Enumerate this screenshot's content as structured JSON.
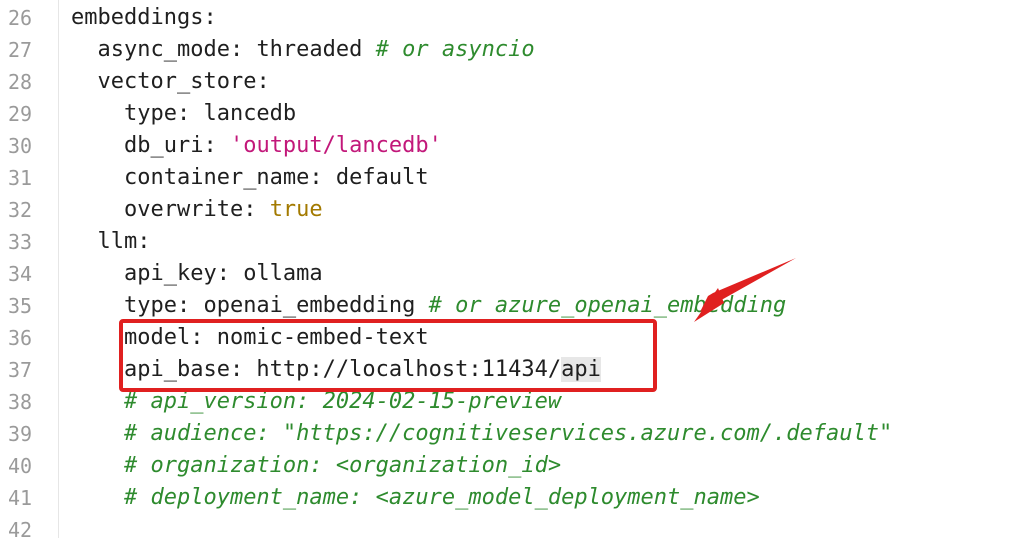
{
  "editor": {
    "lines": [
      {
        "num": "26",
        "indent": "",
        "parts": [
          {
            "t": "embeddings:",
            "c": "key"
          }
        ]
      },
      {
        "num": "27",
        "indent": "  ",
        "parts": [
          {
            "t": "async_mode: threaded ",
            "c": "key"
          },
          {
            "t": "# or asyncio",
            "c": "cmt"
          }
        ]
      },
      {
        "num": "28",
        "indent": "  ",
        "parts": [
          {
            "t": "vector_store:",
            "c": "key"
          }
        ]
      },
      {
        "num": "29",
        "indent": "    ",
        "parts": [
          {
            "t": "type: lancedb",
            "c": "key"
          }
        ]
      },
      {
        "num": "30",
        "indent": "    ",
        "parts": [
          {
            "t": "db_uri: ",
            "c": "key"
          },
          {
            "t": "'output/lancedb'",
            "c": "str"
          }
        ]
      },
      {
        "num": "31",
        "indent": "    ",
        "parts": [
          {
            "t": "container_name: default",
            "c": "key"
          }
        ]
      },
      {
        "num": "32",
        "indent": "    ",
        "parts": [
          {
            "t": "overwrite: ",
            "c": "key"
          },
          {
            "t": "true",
            "c": "bool"
          }
        ]
      },
      {
        "num": "33",
        "indent": "  ",
        "parts": [
          {
            "t": "llm:",
            "c": "key"
          }
        ]
      },
      {
        "num": "34",
        "indent": "    ",
        "parts": [
          {
            "t": "api_key: ollama",
            "c": "key"
          }
        ]
      },
      {
        "num": "35",
        "indent": "    ",
        "parts": [
          {
            "t": "type: openai_embedding ",
            "c": "key"
          },
          {
            "t": "# or azure_openai_embedding",
            "c": "cmt"
          }
        ]
      },
      {
        "num": "36",
        "indent": "    ",
        "parts": [
          {
            "t": "model: nomic-embed-text",
            "c": "key"
          }
        ]
      },
      {
        "num": "37",
        "indent": "    ",
        "parts": [
          {
            "t": "api_base: http://localhost:11434/",
            "c": "key"
          },
          {
            "t": "api",
            "c": "hl"
          }
        ]
      },
      {
        "num": "38",
        "indent": "    ",
        "parts": [
          {
            "t": "# api_version: 2024-02-15-preview",
            "c": "cmt"
          }
        ]
      },
      {
        "num": "39",
        "indent": "    ",
        "parts": [
          {
            "t": "# audience: \"https://cognitiveservices.azure.com/.default\"",
            "c": "cmt"
          }
        ]
      },
      {
        "num": "40",
        "indent": "    ",
        "parts": [
          {
            "t": "# organization: <organization_id>",
            "c": "cmt"
          }
        ]
      },
      {
        "num": "41",
        "indent": "    ",
        "parts": [
          {
            "t": "# deployment_name: <azure_model_deployment_name>",
            "c": "cmt"
          }
        ]
      },
      {
        "num": "42",
        "indent": "",
        "parts": []
      }
    ]
  },
  "annotation": {
    "box_color": "#e02020",
    "arrow_color": "#e02020"
  }
}
